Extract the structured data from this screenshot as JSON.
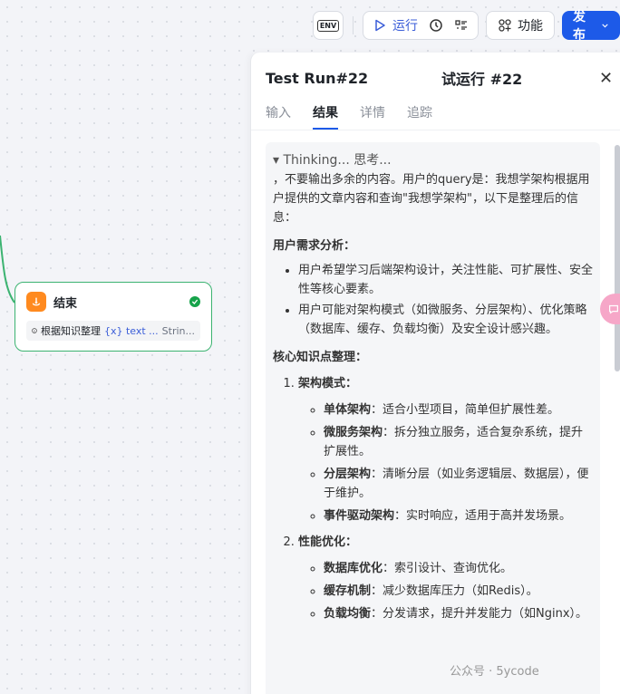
{
  "toolbar": {
    "env_label": "ENV",
    "run_label": "运行",
    "features_label": "功能",
    "publish_label": "发布"
  },
  "node": {
    "title": "结束",
    "row_name": "根据知识整理",
    "row_var": "{x} text ...",
    "row_type": "Strin..."
  },
  "panel": {
    "title": "Test Run#22",
    "title_cn": "试运行 #22",
    "tabs": [
      "输入",
      "结果",
      "详情",
      "追踪"
    ],
    "active_tab": "结果",
    "content": {
      "thinking": "▾ Thinking...  思考...",
      "intro": "，不要输出多余的内容。用户的query是：我想学架构根据用户提供的文章内容和查询\"我想学架构\"，以下是整理后的信息：",
      "section1_title": "用户需求分析：",
      "section1_items": [
        "用户希望学习后端架构设计，关注性能、可扩展性、安全性等核心要素。",
        "用户可能对架构模式（如微服务、分层架构）、优化策略（数据库、缓存、负载均衡）及安全设计感兴趣。"
      ],
      "section2_title": "核心知识点整理：",
      "points": [
        {
          "title": "架构模式：",
          "items": [
            {
              "k": "单体架构",
              "v": "：适合小型项目，简单但扩展性差。"
            },
            {
              "k": "微服务架构",
              "v": "：拆分独立服务，适合复杂系统，提升扩展性。"
            },
            {
              "k": "分层架构",
              "v": "：清晰分层（如业务逻辑层、数据层），便于维护。"
            },
            {
              "k": "事件驱动架构",
              "v": "：实时响应，适用于高并发场景。"
            }
          ]
        },
        {
          "title": "性能优化：",
          "items": [
            {
              "k": "数据库优化",
              "v": "：索引设计、查询优化。"
            },
            {
              "k": "缓存机制",
              "v": "：减少数据库压力（如Redis）。"
            },
            {
              "k": "负载均衡",
              "v": "：分发请求，提升并发能力（如Nginx）。"
            }
          ]
        }
      ]
    }
  },
  "watermark": "公众号 · 5ycode"
}
